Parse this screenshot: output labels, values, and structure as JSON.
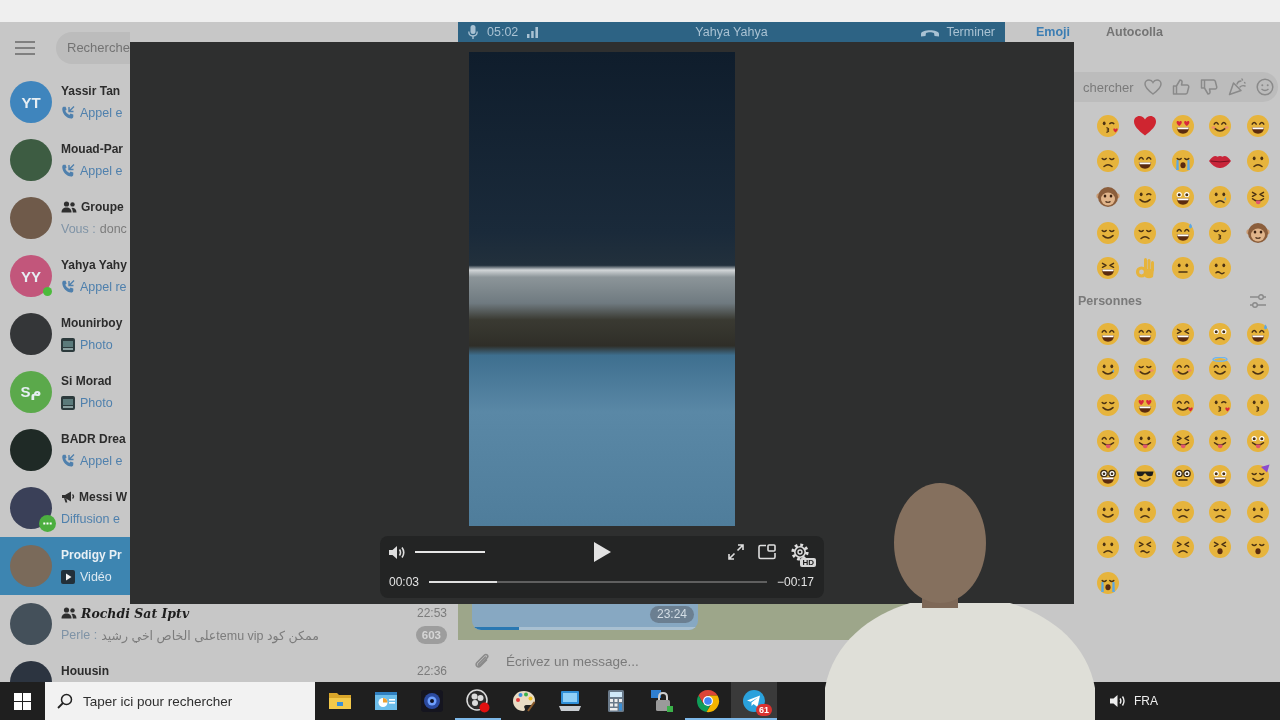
{
  "chat_list": {
    "search": {
      "placeholder": "Recherche"
    },
    "chats": [
      {
        "kind": "private",
        "avatar": {
          "kind": "initials",
          "text": "YT",
          "color": "#3f85bd"
        },
        "name": "Yassir Tan",
        "italic": false,
        "online": false,
        "live": false,
        "selected": false,
        "preview": {
          "kind": "call",
          "text": "Appel e"
        }
      },
      {
        "kind": "private",
        "avatar": {
          "kind": "photo"
        },
        "name": "Mouad-Par",
        "italic": false,
        "online": false,
        "live": false,
        "selected": false,
        "preview": {
          "kind": "call",
          "text": "Appel e"
        }
      },
      {
        "kind": "group",
        "avatar": {
          "kind": "photo"
        },
        "name": "Groupe",
        "italic": false,
        "online": false,
        "live": false,
        "selected": false,
        "preview": {
          "kind": "text",
          "sender": "Vous :",
          "text": "donc"
        }
      },
      {
        "kind": "private",
        "avatar": {
          "kind": "initials",
          "text": "YY",
          "color": "#c2567b"
        },
        "name": "Yahya Yahy",
        "italic": false,
        "online": true,
        "live": false,
        "selected": false,
        "preview": {
          "kind": "call",
          "text": "Appel re"
        }
      },
      {
        "kind": "private",
        "avatar": {
          "kind": "photo"
        },
        "name": "Mounirboy",
        "italic": false,
        "online": false,
        "live": false,
        "selected": false,
        "preview": {
          "kind": "photo",
          "text": "Photo"
        }
      },
      {
        "kind": "private",
        "avatar": {
          "kind": "initials",
          "text": "Sم",
          "color": "#5ba94b"
        },
        "name": "Si Morad",
        "italic": false,
        "online": false,
        "live": false,
        "selected": false,
        "preview": {
          "kind": "photo",
          "text": "Photo"
        }
      },
      {
        "kind": "private",
        "avatar": {
          "kind": "photo"
        },
        "name": "BADR Drea",
        "italic": false,
        "online": false,
        "live": false,
        "selected": false,
        "preview": {
          "kind": "call",
          "text": "Appel e"
        }
      },
      {
        "kind": "channel",
        "avatar": {
          "kind": "photo"
        },
        "name": "Messi W",
        "italic": false,
        "online": false,
        "live": true,
        "selected": false,
        "preview": {
          "kind": "service",
          "text": "Diffusion e"
        }
      },
      {
        "kind": "private",
        "avatar": {
          "kind": "photo"
        },
        "name": "Prodigy Pr",
        "italic": false,
        "online": false,
        "live": false,
        "selected": true,
        "preview": {
          "kind": "video",
          "text": "Vidéo"
        }
      },
      {
        "kind": "group",
        "avatar": {
          "kind": "photo"
        },
        "name": "Rochdi Sat Iptv",
        "italic": true,
        "online": false,
        "live": false,
        "selected": false,
        "time": "22:53",
        "unread": "603",
        "preview": {
          "kind": "text",
          "sender": "Perle :",
          "text": "ممكن كود temu vipعلى الخاص اخي رشيد"
        }
      },
      {
        "kind": "private",
        "avatar": {
          "kind": "photo"
        },
        "name": "Houusin",
        "italic": false,
        "online": false,
        "live": false,
        "selected": false,
        "time": "22:36"
      }
    ]
  },
  "call_bar": {
    "timer": "05:02",
    "name": "Yahya Yahya",
    "end_label": "Terminer"
  },
  "chat": {
    "video_message": {
      "time": "23:24",
      "level": 0.21
    },
    "composer": {
      "placeholder": "Écrivez un message..."
    }
  },
  "emoji_panel": {
    "tabs": [
      {
        "label": "Emoji",
        "selected": true
      },
      {
        "label": "Autocolla",
        "selected": false
      }
    ],
    "search": {
      "placeholder": "chercher"
    },
    "section_title": "Personnes"
  },
  "media_viewer": {
    "playing": false,
    "volume": {
      "level": 1
    },
    "position": "00:03",
    "progress": {
      "level": 0.2
    },
    "remaining": "−00:17",
    "quality": "HD"
  },
  "taskbar": {
    "search": {
      "placeholder": "Taper ici pour rechercher"
    },
    "apps": [
      {
        "running": false,
        "active": false
      },
      {
        "running": false,
        "active": false
      },
      {
        "running": false,
        "active": false
      },
      {
        "running": true,
        "active": false
      },
      {
        "running": false,
        "active": false
      },
      {
        "running": false,
        "active": false
      },
      {
        "running": false,
        "active": false
      },
      {
        "running": false,
        "active": false
      },
      {
        "running": true,
        "active": false
      },
      {
        "running": true,
        "active": true,
        "badge": "61"
      }
    ],
    "language": "FRA"
  }
}
